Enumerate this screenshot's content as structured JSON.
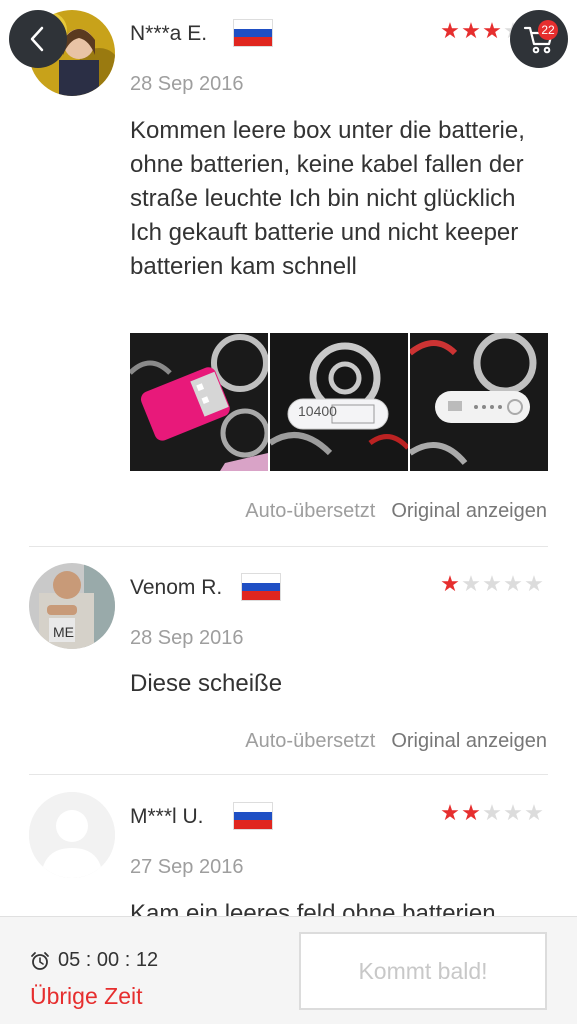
{
  "header": {
    "cart_count": "22"
  },
  "reviews": [
    {
      "name": "N***a E.",
      "date": "28 Sep 2016",
      "stars": 3,
      "text": "Kommen leere box unter die batterie, ohne batterien, keine kabel fallen der straße leuchte Ich bin nicht glücklich Ich gekauft batterie und nicht keeper batterien kam schnell",
      "photo_texts": [
        "10400"
      ],
      "auto_translated": "Auto-übersetzt",
      "show_original": "Original anzeigen"
    },
    {
      "name": "Venom R.",
      "date": "28 Sep 2016",
      "stars": 1,
      "text": "Diese scheiße",
      "auto_translated": "Auto-übersetzt",
      "show_original": "Original anzeigen"
    },
    {
      "name": "M***l U.",
      "date": "27 Sep 2016",
      "stars": 2,
      "text": "Kam ein leeres feld ohne batterien"
    }
  ],
  "bottom_bar": {
    "timer": "05 : 00 : 12",
    "remaining_label": "Übrige Zeit",
    "button_label": "Kommt bald!"
  },
  "colors": {
    "accent": "#e62e2e",
    "fab_bg": "#2f3338",
    "muted_text": "#9e9e9e"
  }
}
